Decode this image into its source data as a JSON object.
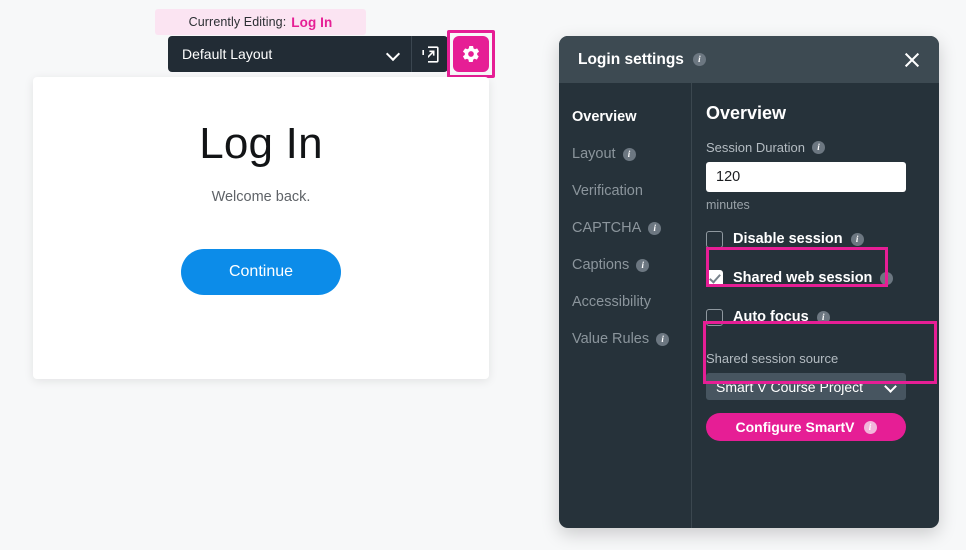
{
  "editing_banner": {
    "prefix": "Currently Editing:",
    "value": "Log In"
  },
  "toolbar": {
    "layout_value": "Default Layout",
    "chevron_icon": "chevron-down-icon",
    "popout_icon": "open-in-new-window-icon",
    "gear_icon": "gear-icon"
  },
  "login_preview": {
    "title": "Log In",
    "subtitle": "Welcome back.",
    "continue_label": "Continue",
    "button_color": "#0c8ce9"
  },
  "settings_panel": {
    "title": "Login settings",
    "title_info_icon": "info-icon",
    "close_icon": "close-icon",
    "sidebar": {
      "items": [
        {
          "label": "Overview",
          "info": false,
          "active": true
        },
        {
          "label": "Layout",
          "info": true,
          "active": false
        },
        {
          "label": "Verification",
          "info": false,
          "active": false
        },
        {
          "label": "CAPTCHA",
          "info": true,
          "active": false
        },
        {
          "label": "Captions",
          "info": true,
          "active": false
        },
        {
          "label": "Accessibility",
          "info": false,
          "active": false
        },
        {
          "label": "Value Rules",
          "info": true,
          "active": false
        }
      ]
    },
    "content": {
      "heading": "Overview",
      "session_duration": {
        "label": "Session Duration",
        "value": "120",
        "units": "minutes"
      },
      "checkboxes": [
        {
          "label": "Disable session",
          "checked": false,
          "info": true
        },
        {
          "label": "Shared web session",
          "checked": true,
          "info": true
        },
        {
          "label": "Auto focus",
          "checked": false,
          "info": true
        }
      ],
      "shared_session_source": {
        "label": "Shared session source",
        "selected": "Smart V Course Project",
        "chevron_icon": "chevron-down-icon"
      },
      "configure_button": {
        "label": "Configure SmartV",
        "info": true,
        "color": "#e61e95"
      }
    }
  },
  "annotations": {
    "highlight_color": "#e61e95",
    "boxes": [
      {
        "name": "gear-button"
      },
      {
        "name": "shared-web-session-checkbox"
      },
      {
        "name": "shared-session-source-group"
      }
    ]
  }
}
